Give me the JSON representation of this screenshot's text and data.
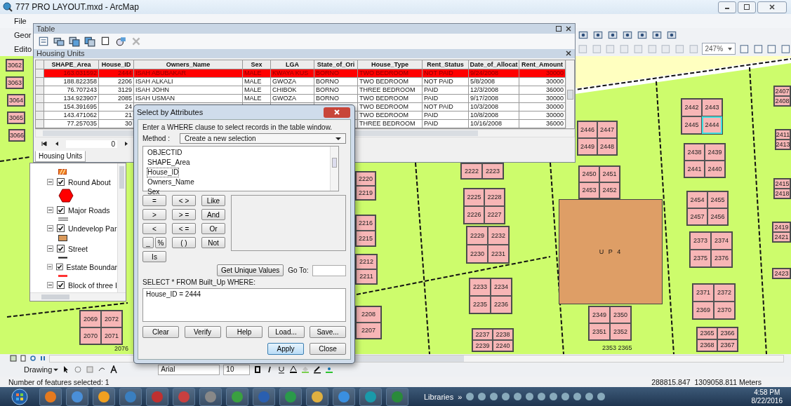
{
  "app": {
    "title": "777 PRO LAYOUT.mxd - ArcMap"
  },
  "menu": [
    {
      "label": "File"
    }
  ],
  "toolbars": [
    {
      "label": "Geor"
    },
    {
      "label": "Edito"
    }
  ],
  "zoom_field": {
    "value": "247%"
  },
  "table_window": {
    "title": "Table",
    "table_title": "Housing Units",
    "columns": [
      "SHAPE_Area",
      "House_ID",
      "Owners_Name",
      "Sex",
      "LGA",
      "State_of_Ori",
      "House_Type",
      "Rent_Status",
      "Date_of_Allocat",
      "Rent_Amount"
    ],
    "rows": [
      {
        "selected": true,
        "cells": [
          "163.031592",
          "2444",
          "ISAH ABUBAKAR",
          "MALE",
          "KWAYA KUS",
          "BORNO",
          "TWO BEDROOM",
          "NOT PAID",
          "9/24/2008",
          "30000"
        ]
      },
      {
        "selected": false,
        "cells": [
          "188.822358",
          "2206",
          "ISAH ALKALI",
          "MALE",
          "GWOZA",
          "BORNO",
          "TWO BEDROOM",
          "NOT PAID",
          "5/8/2008",
          "30000"
        ]
      },
      {
        "selected": false,
        "cells": [
          "76.707243",
          "3129",
          "ISAH JOHN",
          "MALE",
          "CHIBOK",
          "BORNO",
          "THREE BEDROOM",
          "PAID",
          "12/3/2008",
          "36000"
        ]
      },
      {
        "selected": false,
        "cells": [
          "134.923907",
          "2085",
          "ISAH USMAN",
          "MALE",
          "GWOZA",
          "BORNO",
          "TWO BEDROOM",
          "PAID",
          "9/17/2008",
          "30000"
        ]
      },
      {
        "selected": false,
        "cells": [
          "154.391695",
          "24",
          null,
          null,
          null,
          null,
          "TWO BEDROOM",
          "NOT PAID",
          "10/3/2008",
          "30000"
        ]
      },
      {
        "selected": false,
        "cells": [
          "143.471062",
          "21",
          null,
          null,
          null,
          null,
          "TWO BEDROOM",
          "PAID",
          "10/8/2008",
          "30000"
        ]
      },
      {
        "selected": false,
        "cells": [
          "77.257035",
          "30",
          null,
          null,
          null,
          null,
          "THREE BEDROOM",
          "PAID",
          "10/16/2008",
          "36000"
        ]
      }
    ],
    "record_field": {
      "value": "0"
    },
    "tab": {
      "label": "Housing Units",
      "selected": true
    }
  },
  "toc": {
    "items": [
      {
        "label": "Round About",
        "checked": true,
        "kind": "hexagon"
      },
      {
        "label": "Major Roads",
        "checked": true,
        "kind": "road"
      },
      {
        "label": "Undevelop Par",
        "checked": true,
        "kind": "fill"
      },
      {
        "label": "Street",
        "checked": true,
        "kind": "street"
      },
      {
        "label": "Estate Boundar",
        "checked": true,
        "kind": "boundary"
      },
      {
        "label": "Block of three I",
        "checked": true,
        "kind": "plain"
      }
    ]
  },
  "dialog": {
    "title": "Select by Attributes",
    "instruction": "Enter a WHERE clause to select records in the table window.",
    "method_label": "Method :",
    "method": "Create a new selection",
    "fields": [
      {
        "label": "OBJECTID",
        "selected": false
      },
      {
        "label": "SHAPE_Area",
        "selected": false
      },
      {
        "label": "House_ID",
        "selected": true
      },
      {
        "label": "Owners_Name",
        "selected": false
      },
      {
        "label": "Sex",
        "selected": false
      }
    ],
    "operators": [
      "=",
      "< >",
      "Like",
      ">",
      "> =",
      "And",
      "<",
      "< =",
      "Or",
      "_",
      "%",
      "( )",
      "Not",
      "Is"
    ],
    "unique_button": "Get Unique Values",
    "goto_label": "Go To:",
    "query_label": "SELECT * FROM Built_Up WHERE:",
    "query": "House_ID = 2444",
    "buttons": [
      "Clear",
      "Verify",
      "Help",
      "Load...",
      "Save..."
    ],
    "apply": "Apply",
    "close": "Close"
  },
  "map": {
    "blocks": [
      {
        "parcels": [
          {
            "label": "3062",
            "selected": false
          }
        ]
      },
      {
        "parcels": [
          {
            "label": "3063",
            "selected": false
          }
        ]
      },
      {
        "parcels": [
          {
            "label": "3064",
            "selected": false
          }
        ]
      },
      {
        "parcels": [
          {
            "label": "3065",
            "selected": false
          }
        ]
      },
      {
        "parcels": [
          {
            "label": "3066",
            "selected": false
          }
        ]
      },
      {
        "parcels": [
          {
            "label": "2446",
            "selected": false
          },
          {
            "label": "2447",
            "selected": false
          },
          {
            "label": "2449",
            "selected": false
          },
          {
            "label": "2448",
            "selected": false
          }
        ]
      },
      {
        "parcels": [
          {
            "label": "2442",
            "selected": false
          },
          {
            "label": "2443",
            "selected": false
          },
          {
            "label": "2445",
            "selected": false
          },
          {
            "label": "2444",
            "selected": true
          }
        ]
      },
      {
        "parcels": [
          {
            "label": "2407",
            "selected": false
          },
          {
            "label": "2408",
            "selected": false
          }
        ]
      },
      {
        "parcels": [
          {
            "label": "2220",
            "selected": false
          },
          {
            "label": "2219",
            "selected": false
          }
        ]
      },
      {
        "parcels": [
          {
            "label": "2222",
            "selected": false
          },
          {
            "label": "2223",
            "selected": false
          }
        ]
      },
      {
        "parcels": [
          {
            "label": "2438",
            "selected": false
          },
          {
            "label": "2439",
            "selected": false
          },
          {
            "label": "2441",
            "selected": false
          },
          {
            "label": "2440",
            "selected": false
          }
        ]
      },
      {
        "parcels": [
          {
            "label": "2411",
            "selected": false
          },
          {
            "label": "2413",
            "selected": false
          }
        ]
      },
      {
        "parcels": [
          {
            "label": "2216",
            "selected": false
          },
          {
            "label": "2215",
            "selected": false
          }
        ]
      },
      {
        "parcels": [
          {
            "label": "2225",
            "selected": false
          },
          {
            "label": "2228",
            "selected": false
          },
          {
            "label": "2226",
            "selected": false
          },
          {
            "label": "2227",
            "selected": false
          }
        ]
      },
      {
        "parcels": [
          {
            "label": "2450",
            "selected": false
          },
          {
            "label": "2451",
            "selected": false
          },
          {
            "label": "2453",
            "selected": false
          },
          {
            "label": "2452",
            "selected": false
          }
        ]
      },
      {
        "parcels": [
          {
            "label": "2454",
            "selected": false
          },
          {
            "label": "2455",
            "selected": false
          },
          {
            "label": "2457",
            "selected": false
          },
          {
            "label": "2456",
            "selected": false
          }
        ]
      },
      {
        "parcels": [
          {
            "label": "2415",
            "selected": false
          },
          {
            "label": "2418",
            "selected": false
          }
        ]
      },
      {
        "parcels": [
          {
            "label": "2212",
            "selected": false
          },
          {
            "label": "2211",
            "selected": false
          }
        ]
      },
      {
        "parcels": [
          {
            "label": "2229",
            "selected": false
          },
          {
            "label": "2232",
            "selected": false
          },
          {
            "label": "2230",
            "selected": false
          },
          {
            "label": "2231",
            "selected": false
          }
        ]
      },
      {
        "parcels": [
          {
            "label": "2373",
            "selected": false
          },
          {
            "label": "2374",
            "selected": false
          },
          {
            "label": "2375",
            "selected": false
          },
          {
            "label": "2376",
            "selected": false
          }
        ]
      },
      {
        "parcels": [
          {
            "label": "2419",
            "selected": false
          },
          {
            "label": "2421",
            "selected": false
          }
        ]
      },
      {
        "parcels": [
          {
            "label": "2423",
            "selected": false
          }
        ]
      },
      {
        "parcels": [
          {
            "label": "2069",
            "selected": false
          },
          {
            "label": "2072",
            "selected": false
          },
          {
            "label": "2070",
            "selected": false
          },
          {
            "label": "2071",
            "selected": false
          }
        ]
      },
      {
        "parcels": [
          {
            "label": "2208",
            "selected": false
          },
          {
            "label": "2207",
            "selected": false
          }
        ]
      },
      {
        "parcels": [
          {
            "label": "2233",
            "selected": false
          },
          {
            "label": "2234",
            "selected": false
          },
          {
            "label": "2235",
            "selected": false
          },
          {
            "label": "2236",
            "selected": false
          }
        ]
      },
      {
        "parcels": [
          {
            "label": "2237",
            "selected": false
          },
          {
            "label": "2238",
            "selected": false
          },
          {
            "label": "2239",
            "selected": false
          },
          {
            "label": "2240",
            "selected": false
          }
        ]
      },
      {
        "parcels": [
          {
            "label": "2349",
            "selected": false
          },
          {
            "label": "2350",
            "selected": false
          },
          {
            "label": "2351",
            "selected": false
          },
          {
            "label": "2352",
            "selected": false
          }
        ]
      },
      {
        "parcels": [
          {
            "label": "2371",
            "selected": false
          },
          {
            "label": "2372",
            "selected": false
          },
          {
            "label": "2369",
            "selected": false
          },
          {
            "label": "2370",
            "selected": false
          }
        ]
      },
      {
        "parcels": [
          {
            "label": "2365",
            "selected": false
          },
          {
            "label": "2366",
            "selected": false
          },
          {
            "label": "2368",
            "selected": false
          },
          {
            "label": "2367",
            "selected": false
          }
        ]
      }
    ],
    "labels": [
      "2076",
      "2353 2365"
    ],
    "zone": {
      "label": "U P 4"
    }
  },
  "drawing_toolbar": {
    "label": "Drawing",
    "font": "Arial",
    "size": "10"
  },
  "status_bar": {
    "message": "Number of features selected: 1",
    "coordinates": "288815.847  1309058.811 Meters"
  },
  "taskbar": {
    "label": "Libraries",
    "chevron": "»",
    "time": "4:58 PM",
    "date": "8/22/2016"
  }
}
